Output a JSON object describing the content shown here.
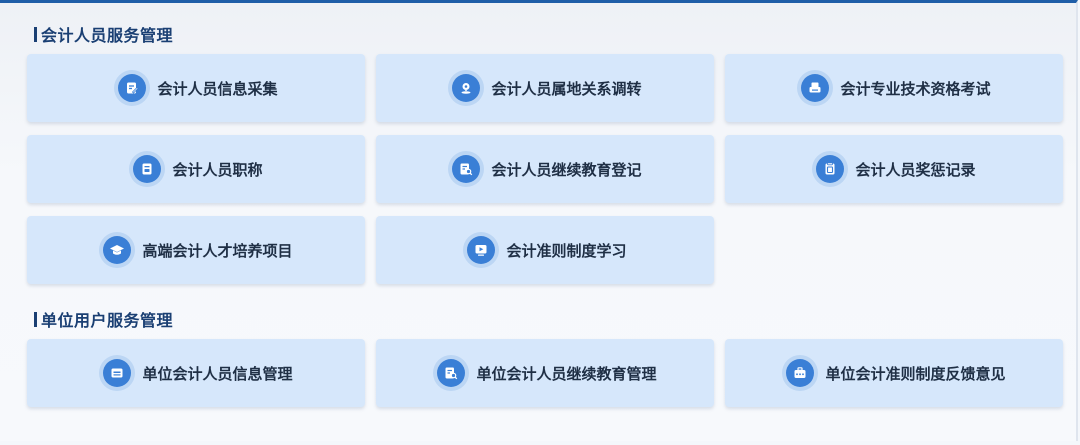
{
  "sections": [
    {
      "title": "会计人员服务管理",
      "items": [
        {
          "label": "会计人员信息采集",
          "icon": "edit-form-icon"
        },
        {
          "label": "会计人员属地关系调转",
          "icon": "location-pin-icon"
        },
        {
          "label": "会计专业技术资格考试",
          "icon": "exam-printer-icon"
        },
        {
          "label": "会计人员职称",
          "icon": "certificate-icon"
        },
        {
          "label": "会计人员继续教育登记",
          "icon": "document-search-icon"
        },
        {
          "label": "会计人员奖惩记录",
          "icon": "record-book-icon"
        },
        {
          "label": "高端会计人才培养项目",
          "icon": "graduation-cap-icon"
        },
        {
          "label": "会计准则制度学习",
          "icon": "video-play-icon"
        }
      ]
    },
    {
      "title": "单位用户服务管理",
      "items": [
        {
          "label": "单位会计人员信息管理",
          "icon": "id-card-icon"
        },
        {
          "label": "单位会计人员继续教育管理",
          "icon": "document-search-icon"
        },
        {
          "label": "单位会计准则制度反馈意见",
          "icon": "briefcase-icon"
        }
      ]
    }
  ],
  "colors": {
    "card_bg": "#d6e7fb",
    "icon_disc": "#3a7fd6",
    "title_text": "#1a3f73",
    "accent_top": "#1f5ea8"
  }
}
